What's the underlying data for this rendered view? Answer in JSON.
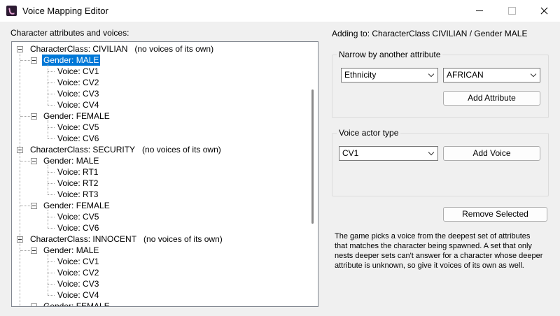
{
  "window": {
    "title": "Voice Mapping Editor"
  },
  "tree_heading": "Character attributes and voices:",
  "tree": [
    {
      "text": "CharacterClass: CIVILIAN",
      "note": "(no voices of its own)",
      "level": 0,
      "expander": true
    },
    {
      "text": "Gender: MALE",
      "level": 1,
      "expander": true,
      "selected": true
    },
    {
      "text": "Voice: CV1",
      "level": 2
    },
    {
      "text": "Voice: CV2",
      "level": 2
    },
    {
      "text": "Voice: CV3",
      "level": 2
    },
    {
      "text": "Voice: CV4",
      "level": 2
    },
    {
      "text": "Gender: FEMALE",
      "level": 1,
      "expander": true
    },
    {
      "text": "Voice: CV5",
      "level": 2
    },
    {
      "text": "Voice: CV6",
      "level": 2
    },
    {
      "text": "CharacterClass: SECURITY",
      "note": "(no voices of its own)",
      "level": 0,
      "expander": true
    },
    {
      "text": "Gender: MALE",
      "level": 1,
      "expander": true
    },
    {
      "text": "Voice: RT1",
      "level": 2
    },
    {
      "text": "Voice: RT2",
      "level": 2
    },
    {
      "text": "Voice: RT3",
      "level": 2
    },
    {
      "text": "Gender: FEMALE",
      "level": 1,
      "expander": true
    },
    {
      "text": "Voice: CV5",
      "level": 2
    },
    {
      "text": "Voice: CV6",
      "level": 2
    },
    {
      "text": "CharacterClass: INNOCENT",
      "note": "(no voices of its own)",
      "level": 0,
      "expander": true
    },
    {
      "text": "Gender: MALE",
      "level": 1,
      "expander": true
    },
    {
      "text": "Voice: CV1",
      "level": 2
    },
    {
      "text": "Voice: CV2",
      "level": 2
    },
    {
      "text": "Voice: CV3",
      "level": 2
    },
    {
      "text": "Voice: CV4",
      "level": 2
    },
    {
      "text": "Gender: FEMALE",
      "level": 1,
      "expander": true
    }
  ],
  "adding_to": "Adding to: CharacterClass CIVILIAN / Gender MALE",
  "narrow_group": {
    "title": "Narrow by another attribute",
    "attribute_value": "Ethnicity",
    "value_value": "AFRICAN",
    "add_button": "Add Attribute"
  },
  "voice_group": {
    "title": "Voice actor type",
    "voice_value": "CV1",
    "add_button": "Add Voice"
  },
  "remove_button": "Remove Selected",
  "help_text": "The game picks a voice from the deepest set of attributes that matches the character being spawned. A set that only nests deeper sets can't answer for a character whose deeper attribute is unknown, so give it voices of its own as well."
}
